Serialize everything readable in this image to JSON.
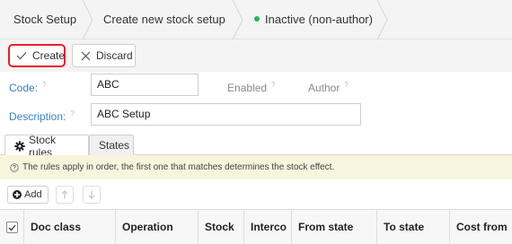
{
  "breadcrumb": {
    "items": [
      "Stock Setup",
      "Create new stock setup"
    ],
    "status": "Inactive (non-author)",
    "status_color": "#21b35c"
  },
  "toolbar": {
    "create_label": "Create",
    "discard_label": "Discard",
    "highlight_color": "#e5202e"
  },
  "form": {
    "code_label": "Code:",
    "code_value": "ABC",
    "description_label": "Description:",
    "description_value": "ABC Setup",
    "enabled_label": "Enabled",
    "author_label": "Author",
    "help_mark": "?"
  },
  "tabs": [
    {
      "label": "Stock rules",
      "icon": "gear-icon",
      "active": true
    },
    {
      "label": "States",
      "active": false
    }
  ],
  "info": {
    "icon": "question-circle-icon",
    "text": "The rules apply in order, the first one that matches determines the stock effect."
  },
  "actions": {
    "add_label": "Add"
  },
  "table": {
    "columns": [
      "Doc class",
      "Operation",
      "Stock",
      "Interco",
      "From state",
      "To state",
      "Cost from"
    ]
  }
}
